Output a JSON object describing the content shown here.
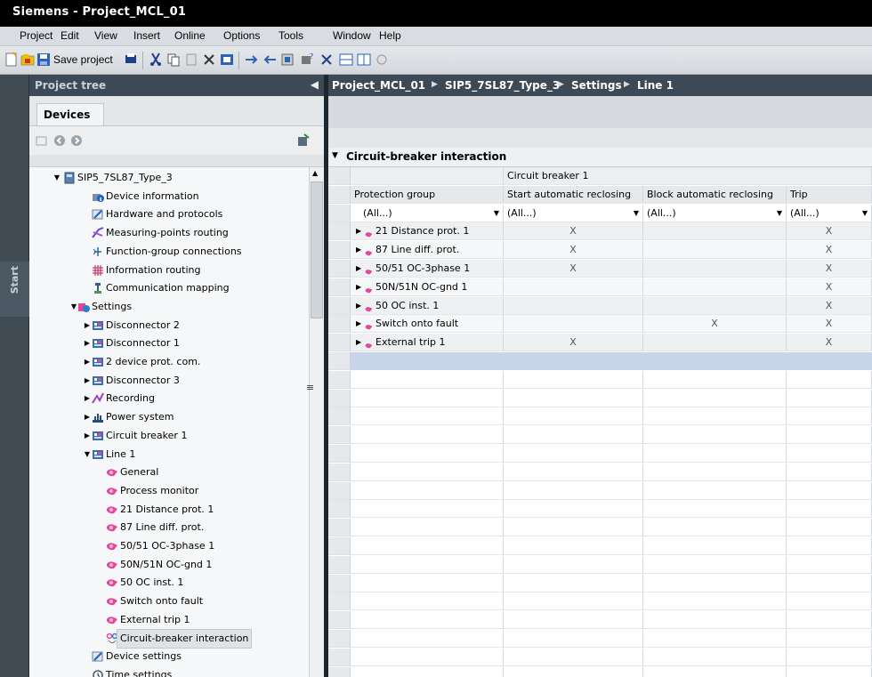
{
  "window": {
    "title": "Siemens  -  Project_MCL_01"
  },
  "menu": [
    "Project",
    "Edit",
    "View",
    "Insert",
    "Online",
    "Options",
    "Tools",
    "Window",
    "Help"
  ],
  "toolbar": {
    "save_label": "Save project"
  },
  "start_strip": {
    "label": "Start"
  },
  "project_tree": {
    "header": "Project tree",
    "tab": "Devices",
    "items": [
      {
        "label": "SIP5_7SL87_Type_3",
        "icon": "device-icon",
        "level": 0,
        "arrow": "down"
      },
      {
        "label": "Device information",
        "icon": "info-icon",
        "level": 2,
        "arrow": ""
      },
      {
        "label": "Hardware and protocols",
        "icon": "hardware-icon",
        "level": 2,
        "arrow": ""
      },
      {
        "label": "Measuring-points routing",
        "icon": "measuring-icon",
        "level": 2,
        "arrow": ""
      },
      {
        "label": "Function-group connections",
        "icon": "connection-icon",
        "level": 2,
        "arrow": ""
      },
      {
        "label": "Information routing",
        "icon": "routing-icon",
        "level": 2,
        "arrow": ""
      },
      {
        "label": "Communication mapping",
        "icon": "comm-icon",
        "level": 2,
        "arrow": ""
      },
      {
        "label": "Settings",
        "icon": "settings-icon",
        "level": 1,
        "arrow": "down"
      },
      {
        "label": "Disconnector 2",
        "icon": "function-group-icon",
        "level": 2,
        "arrow": "right"
      },
      {
        "label": "Disconnector 1",
        "icon": "function-group-icon",
        "level": 2,
        "arrow": "right"
      },
      {
        "label": "2 device prot. com.",
        "icon": "function-group-icon",
        "level": 2,
        "arrow": "right"
      },
      {
        "label": "Disconnector 3",
        "icon": "function-group-icon",
        "level": 2,
        "arrow": "right"
      },
      {
        "label": "Recording",
        "icon": "recording-icon",
        "level": 2,
        "arrow": "right"
      },
      {
        "label": "Power system",
        "icon": "power-icon",
        "level": 2,
        "arrow": "right"
      },
      {
        "label": "Circuit breaker 1",
        "icon": "function-group-icon",
        "level": 2,
        "arrow": "right"
      },
      {
        "label": "Line 1",
        "icon": "function-group-icon",
        "level": 2,
        "arrow": "down"
      },
      {
        "label": "General",
        "icon": "function-icon",
        "level": 3,
        "arrow": ""
      },
      {
        "label": "Process monitor",
        "icon": "function-icon",
        "level": 3,
        "arrow": ""
      },
      {
        "label": "21 Distance prot. 1",
        "icon": "function-icon",
        "level": 3,
        "arrow": ""
      },
      {
        "label": "87 Line diff. prot.",
        "icon": "function-icon",
        "level": 3,
        "arrow": ""
      },
      {
        "label": "50/51 OC-3phase 1",
        "icon": "function-icon",
        "level": 3,
        "arrow": ""
      },
      {
        "label": "50N/51N OC-gnd 1",
        "icon": "function-icon",
        "level": 3,
        "arrow": ""
      },
      {
        "label": "50 OC inst. 1",
        "icon": "function-icon",
        "level": 3,
        "arrow": ""
      },
      {
        "label": "Switch onto fault",
        "icon": "function-icon",
        "level": 3,
        "arrow": ""
      },
      {
        "label": "External trip 1",
        "icon": "function-icon",
        "level": 3,
        "arrow": ""
      },
      {
        "label": "Circuit-breaker interaction",
        "icon": "interaction-icon",
        "level": 3,
        "arrow": "",
        "selected": true
      },
      {
        "label": "Device settings",
        "icon": "hardware-icon",
        "level": 2,
        "arrow": ""
      },
      {
        "label": "Time settings",
        "icon": "time-icon",
        "level": 2,
        "arrow": ""
      }
    ]
  },
  "breadcrumb": [
    "Project_MCL_01",
    "SIP5_7SL87_Type_3",
    "Settings",
    "Line 1"
  ],
  "editor": {
    "section_title": "Circuit-breaker interaction",
    "group_header": "Circuit breaker 1",
    "columns": [
      "Protection group",
      "Start automatic reclosing",
      "Block automatic reclosing",
      "Trip"
    ],
    "filter_value": "(All...)",
    "rows": [
      {
        "name": "21 Distance prot. 1",
        "start": "X",
        "block": "",
        "trip": "X"
      },
      {
        "name": "87 Line diff. prot.",
        "start": "X",
        "block": "",
        "trip": "X"
      },
      {
        "name": "50/51 OC-3phase 1",
        "start": "X",
        "block": "",
        "trip": "X"
      },
      {
        "name": "50N/51N OC-gnd 1",
        "start": "",
        "block": "",
        "trip": "X"
      },
      {
        "name": "50 OC inst. 1",
        "start": "",
        "block": "",
        "trip": "X"
      },
      {
        "name": "Switch onto fault",
        "start": "",
        "block": "X",
        "trip": "X"
      },
      {
        "name": "External trip 1",
        "start": "X",
        "block": "",
        "trip": "X"
      }
    ]
  },
  "colors": {
    "title_bar": "#000000",
    "panel_header": "#3d4954",
    "function_icon": "#e0489a",
    "selection_row": "#c8d4ea"
  }
}
